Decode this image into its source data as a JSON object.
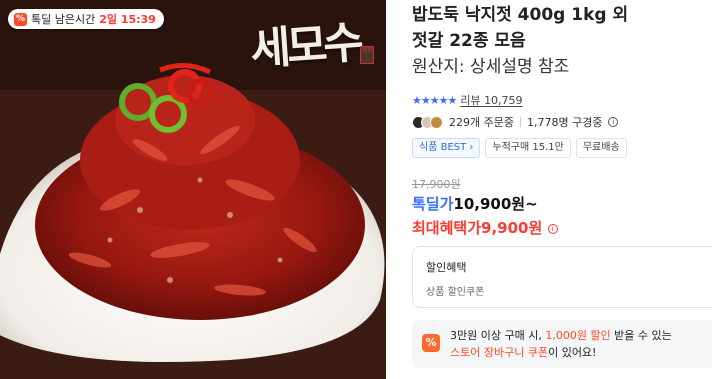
{
  "deal_badge": {
    "pct_icon": "%",
    "label": "톡딜 남은시간",
    "time": "2일 15:39"
  },
  "brand_mark": {
    "text": "세모수",
    "seal": "정품"
  },
  "product": {
    "title_line1": "밥도둑 낙지젓 400g 1kg 외",
    "title_line2": "젓갈 22종 모음",
    "title_line3": "원산지: 상세설명 참조"
  },
  "rating": {
    "stars": "★★★★★",
    "review_label": "리뷰",
    "review_count": "10,759"
  },
  "stats": {
    "orders": "229개 주문중",
    "subscribers": "1,778명 구경중",
    "info_icon": "i"
  },
  "tags": {
    "best": "식품 BEST",
    "best_arrow": "›",
    "cumulative": "누적구매 15.1만",
    "shipping": "무료배송"
  },
  "price": {
    "original": "17,900원",
    "deal_label": "톡딜가",
    "deal_value": "10,900원~",
    "max_label": "최대혜택가",
    "max_value": "9,900원",
    "max_icon": "i"
  },
  "discount": {
    "heading": "할인혜택",
    "detail": "상품 할인쿠폰"
  },
  "coupon": {
    "icon": "%",
    "text_pre": "3만원 이상 구매 시, ",
    "text_hl1": "1,000원 할인",
    "text_mid": " 받을 수 있는",
    "text_hl2": "스토어 장바구니 쿠폰",
    "text_post": "이 있어요!"
  },
  "colors": {
    "accent_blue": "#3b6ff5",
    "accent_red": "#ff3b30",
    "coupon_orange": "#ff6a2c"
  }
}
